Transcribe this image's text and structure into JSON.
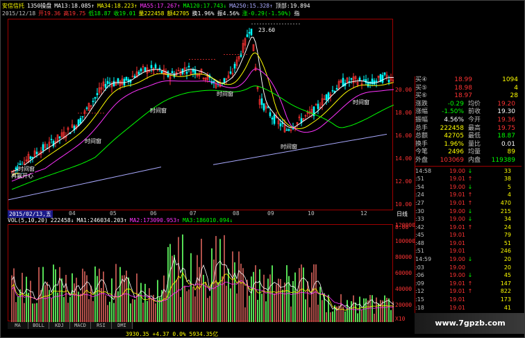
{
  "header": {
    "row1": [
      {
        "text": "安信信托",
        "color": "#ffff00"
      },
      {
        "text": "1350操盘",
        "color": "#ffffff"
      },
      {
        "text": "MA13:18.085↑",
        "color": "#ffffff"
      },
      {
        "text": "MA34:18.223↑",
        "color": "#ffff00"
      },
      {
        "text": "MA55:17.267↑",
        "color": "#ff33ff"
      },
      {
        "text": "MA120:17.743↓",
        "color": "#00ff00"
      },
      {
        "text": "MA250:15.328↑",
        "color": "#aaaaff"
      },
      {
        "text": "顶部:19.894",
        "color": "#ffffff"
      }
    ],
    "row2": [
      {
        "text": "2015/12/18",
        "color": "#c0c0c0"
      },
      {
        "text": "开19.36",
        "color": "#ff3333"
      },
      {
        "text": "高19.75",
        "color": "#ff3333"
      },
      {
        "text": "低18.87",
        "color": "#00ff00"
      },
      {
        "text": "收19.01",
        "color": "#00ff00"
      },
      {
        "text": "量222458",
        "color": "#ffff00"
      },
      {
        "text": "额42705",
        "color": "#ffff00"
      },
      {
        "text": "换1.96%",
        "color": "#ffffff"
      },
      {
        "text": "振4.56%",
        "color": "#ffffff"
      },
      {
        "text": "涨-0.29(-1.50%)",
        "color": "#00ff00"
      },
      {
        "text": "指",
        "color": "#ffffff"
      }
    ]
  },
  "chart_labels": {
    "peak": "23.60",
    "tags": [
      "时间窗",
      "时间窗",
      "时间窗",
      "时间窗",
      "时间窗"
    ],
    "left_tag": "再赢开心"
  },
  "yaxis": [
    "20.00",
    "18.00",
    "16.00",
    "14.00",
    "12.00",
    "10.00",
    "8.00"
  ],
  "xaxis": {
    "date_box": "2015/02/13,五",
    "months": [
      "04",
      "05",
      "06",
      "07",
      "08",
      "09",
      "10",
      "12"
    ],
    "right": "日线"
  },
  "volume_header": [
    {
      "text": "VOL(5,10,20)",
      "color": "#ffffff"
    },
    {
      "text": "222458↓",
      "color": "#ffffff"
    },
    {
      "text": "MA1:246034.203↑",
      "color": "#ffffff"
    },
    {
      "text": "MA2:173090.953↑",
      "color": "#ff33ff"
    },
    {
      "text": "MA3:186010.094↓",
      "color": "#00ff00"
    }
  ],
  "vol_axis": [
    "120000",
    "100000",
    "80000",
    "60000",
    "40000",
    "20000",
    "X10"
  ],
  "tabs": [
    "MA",
    "BOLL",
    "KDJ",
    "MACD",
    "RSI",
    "DMI"
  ],
  "status": "3930.35  +4.37  0.0%  5934.35亿",
  "panel": {
    "bid_rows": [
      {
        "label": "买④",
        "price": "18.99",
        "vol": "1094"
      },
      {
        "label": "买⑤",
        "price": "18.98",
        "vol": "4"
      },
      {
        "label": "买⑥",
        "price": "18.97",
        "vol": "28"
      }
    ],
    "stats": [
      {
        "l1": "涨跌",
        "v1": "-0.29",
        "c1": "#00ff00",
        "l2": "均价",
        "v2": "19.20",
        "c2": "#ff3333"
      },
      {
        "l1": "涨幅",
        "v1": "-1.50%",
        "c1": "#00ff00",
        "l2": "前收",
        "v2": "19.30",
        "c2": "#ffffff"
      },
      {
        "l1": "振幅",
        "v1": "4.56%",
        "c1": "#ffffff",
        "l2": "今开",
        "v2": "19.36",
        "c2": "#ff3333"
      },
      {
        "l1": "总手",
        "v1": "222458",
        "c1": "#ffff00",
        "l2": "最高",
        "v2": "19.75",
        "c2": "#ff3333"
      },
      {
        "l1": "总额",
        "v1": "42705",
        "c1": "#ffff00",
        "l2": "最低",
        "v2": "18.87",
        "c2": "#00ff00"
      },
      {
        "l1": "换手",
        "v1": "1.96%",
        "c1": "#ffff00",
        "l2": "量比",
        "v2": "0.01",
        "c2": "#ffffff"
      },
      {
        "l1": "今笔",
        "v1": "2496",
        "c1": "#ffff00",
        "l2": "均量",
        "v2": "89",
        "c2": "#ffff00"
      },
      {
        "l1": "外盘",
        "v1": "103069",
        "c1": "#ff3333",
        "l2": "内盘",
        "v2": "119389",
        "c2": "#00ff00"
      }
    ],
    "ticks": [
      {
        "t": "14:58",
        "p": "19.00",
        "a": "↓",
        "v": "33",
        "pc": "red",
        "ac": "green"
      },
      {
        "t": ":51",
        "p": "19.01",
        "a": "↑",
        "v": "38",
        "pc": "red",
        "ac": "red"
      },
      {
        "t": ":54",
        "p": "19.00",
        "a": "↓",
        "v": "5",
        "pc": "red",
        "ac": "green"
      },
      {
        "t": ":24",
        "p": "19.01",
        "a": "↑",
        "v": "4",
        "pc": "red",
        "ac": "red"
      },
      {
        "t": ":27",
        "p": "19.01",
        "a": "↑",
        "v": "470",
        "pc": "red",
        "ac": "red"
      },
      {
        "t": ":30",
        "p": "19.00",
        "a": "↓",
        "v": "215",
        "pc": "red",
        "ac": "green"
      },
      {
        "t": ":33",
        "p": "19.00",
        "a": "↓",
        "v": "34",
        "pc": "red",
        "ac": "green"
      },
      {
        "t": ":42",
        "p": "19.01",
        "a": "↑",
        "v": "24",
        "pc": "red",
        "ac": "red"
      },
      {
        "t": ":45",
        "p": "19.01",
        "a": "",
        "v": "79",
        "pc": "red",
        "ac": "red"
      },
      {
        "t": ":48",
        "p": "19.01",
        "a": "",
        "v": "51",
        "pc": "red",
        "ac": "red"
      },
      {
        "t": ":51",
        "p": "19.01",
        "a": "",
        "v": "246",
        "pc": "red",
        "ac": "red"
      },
      {
        "t": "14:59",
        "p": "19.00",
        "a": "↓",
        "v": "20",
        "pc": "red",
        "ac": "green"
      },
      {
        "t": ":03",
        "p": "19.00",
        "a": "",
        "v": "20",
        "pc": "red",
        "ac": "green"
      },
      {
        "t": ":06",
        "p": "19.00",
        "a": "↓",
        "v": "45",
        "pc": "red",
        "ac": "green"
      },
      {
        "t": ":09",
        "p": "19.01",
        "a": "↑",
        "v": "147",
        "pc": "red",
        "ac": "red"
      },
      {
        "t": ":12",
        "p": "19.01",
        "a": "↑",
        "v": "822",
        "pc": "red",
        "ac": "red"
      },
      {
        "t": ":15",
        "p": "19.01",
        "a": "",
        "v": "173",
        "pc": "red",
        "ac": "red"
      },
      {
        "t": ":18",
        "p": "19.01",
        "a": "",
        "v": "41",
        "pc": "red",
        "ac": "red"
      },
      {
        "t": ":21",
        "p": "19.01",
        "a": "",
        "v": "22",
        "pc": "red",
        "ac": "red"
      },
      {
        "t": ":24",
        "p": "19.01",
        "a": "",
        "v": "92",
        "pc": "red",
        "ac": "red"
      }
    ]
  },
  "watermark": "www.7gpzb.com",
  "colors": {
    "up": "#ff3333",
    "down": "#00ffff",
    "border": "#a00000",
    "ma_white": "#ffffff",
    "ma_yellow": "#ffff00",
    "ma_mag": "#ff33ff",
    "ma_green": "#00ff00",
    "ma_blue": "#aaaaff"
  }
}
